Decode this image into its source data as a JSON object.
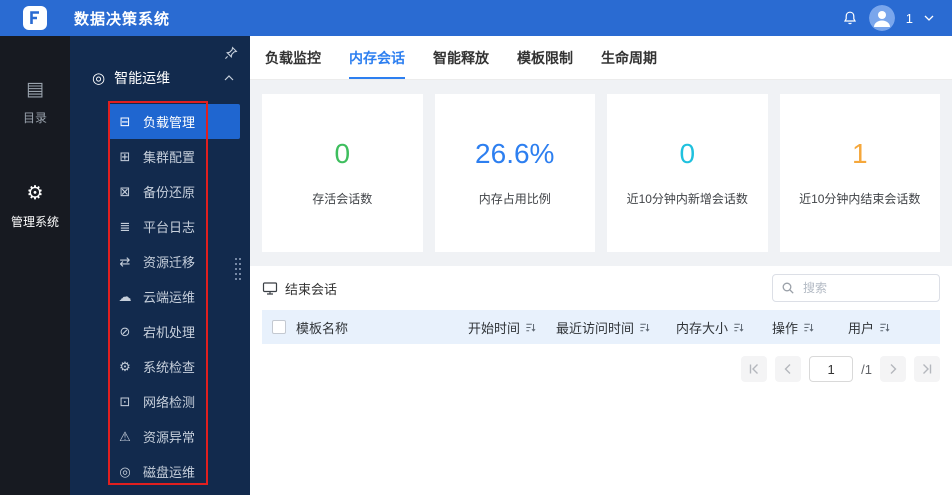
{
  "topbar": {
    "title": "数据决策系统",
    "badge_count": "1"
  },
  "rail": {
    "items": [
      {
        "label": "目录",
        "icon": "catalog-icon",
        "glyph": "▤",
        "active": false
      },
      {
        "label": "管理系统",
        "icon": "gear-icon",
        "glyph": "⚙",
        "active": true
      }
    ]
  },
  "sidebar": {
    "group": {
      "label": "智能运维",
      "icon": "smart-ops-icon",
      "glyph": "◎"
    },
    "items": [
      {
        "label": "负载管理",
        "icon": "load-management-icon",
        "glyph": "⊟",
        "active": true
      },
      {
        "label": "集群配置",
        "icon": "cluster-config-icon",
        "glyph": "⊞",
        "active": false
      },
      {
        "label": "备份还原",
        "icon": "backup-restore-icon",
        "glyph": "⊠",
        "active": false
      },
      {
        "label": "平台日志",
        "icon": "platform-logs-icon",
        "glyph": "≣",
        "active": false
      },
      {
        "label": "资源迁移",
        "icon": "resource-migration-icon",
        "glyph": "⇄",
        "active": false
      },
      {
        "label": "云端运维",
        "icon": "cloud-ops-icon",
        "glyph": "☁",
        "active": false
      },
      {
        "label": "宕机处理",
        "icon": "crash-handling-icon",
        "glyph": "⊘",
        "active": false
      },
      {
        "label": "系统检查",
        "icon": "system-check-icon",
        "glyph": "⚙",
        "active": false
      },
      {
        "label": "网络检测",
        "icon": "network-detection-icon",
        "glyph": "⊡",
        "active": false
      },
      {
        "label": "资源异常",
        "icon": "resource-anomaly-icon",
        "glyph": "⚠",
        "active": false
      },
      {
        "label": "磁盘运维",
        "icon": "disk-ops-icon",
        "glyph": "◎",
        "active": false
      }
    ]
  },
  "tabs": {
    "items": [
      {
        "label": "负载监控",
        "active": false
      },
      {
        "label": "内存会话",
        "active": true
      },
      {
        "label": "智能释放",
        "active": false
      },
      {
        "label": "模板限制",
        "active": false
      },
      {
        "label": "生命周期",
        "active": false
      }
    ]
  },
  "stats": {
    "cards": [
      {
        "value": "0",
        "label": "存活会话数",
        "color": "#3ebe5e"
      },
      {
        "value": "26.6%",
        "label": "内存占用比例",
        "color": "#2d7ff0"
      },
      {
        "value": "0",
        "label": "近10分钟内新增会话数",
        "color": "#1fc1de"
      },
      {
        "value": "1",
        "label": "近10分钟内结束会话数",
        "color": "#f5a73b"
      }
    ]
  },
  "toolbar": {
    "end_session_label": "结束会话",
    "search_placeholder": "搜索"
  },
  "table": {
    "columns": [
      {
        "label": "模板名称",
        "sortable": false
      },
      {
        "label": "开始时间",
        "sortable": true
      },
      {
        "label": "最近访问时间",
        "sortable": true
      },
      {
        "label": "内存大小",
        "sortable": true
      },
      {
        "label": "操作",
        "sortable": true
      },
      {
        "label": "用户",
        "sortable": true
      }
    ],
    "rows": []
  },
  "pagination": {
    "page": "1",
    "total": "/1"
  },
  "colors": {
    "topbar": "#2a6bd2",
    "rail_bg": "#171a21",
    "sidebar_bg": "#122a4d",
    "active_item": "#1f66d0",
    "accent": "#2d7ff0",
    "table_header_bg": "#e8f1fc",
    "panel_bg": "#f0f2f5",
    "annotation_box": "#e01f1f"
  }
}
